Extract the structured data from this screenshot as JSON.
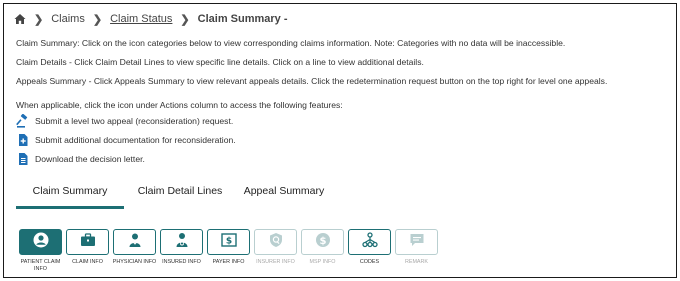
{
  "breadcrumb": {
    "home_icon": "home-icon",
    "items": [
      "Claims",
      "Claim Status",
      "Claim Summary -"
    ]
  },
  "instructions": {
    "summary": "Claim Summary: Click on the icon categories below to view corresponding claims information. Note: Categories with no data will be inaccessible.",
    "details": "Claim Details - Click Claim Detail Lines to view specific line details. Click on a line to view additional details.",
    "appeals": "Appeals Summary - Click Appeals Summary to view relevant appeals details. Click the redetermination request button on the top right for level one appeals.",
    "actions_intro": "When applicable, click the icon under Actions column to access the following features:"
  },
  "actions": [
    {
      "icon": "gavel-icon",
      "label": "Submit a level two appeal (reconsideration) request."
    },
    {
      "icon": "document-add-icon",
      "label": "Submit additional documentation for reconsideration."
    },
    {
      "icon": "document-download-icon",
      "label": "Download the decision letter."
    }
  ],
  "tabs": [
    {
      "label": "Claim Summary",
      "active": true
    },
    {
      "label": "Claim Detail Lines",
      "active": false
    },
    {
      "label": "Appeal Summary",
      "active": false
    }
  ],
  "categories": [
    {
      "label": "PATIENT CLAIM INFO",
      "icon": "user-circle-icon",
      "state": "active"
    },
    {
      "label": "CLAIM INFO",
      "icon": "briefcase-icon",
      "state": "enabled"
    },
    {
      "label": "PHYSICIAN INFO",
      "icon": "physician-icon",
      "state": "enabled"
    },
    {
      "label": "INSURED INFO",
      "icon": "insured-person-icon",
      "state": "enabled"
    },
    {
      "label": "PAYER INFO",
      "icon": "dollar-bill-icon",
      "state": "enabled"
    },
    {
      "label": "INSURER INFO",
      "icon": "shield-icon",
      "state": "disabled"
    },
    {
      "label": "MSP INFO",
      "icon": "dollar-circle-icon",
      "state": "disabled"
    },
    {
      "label": "CODES",
      "icon": "hierarchy-icon",
      "state": "enabled"
    },
    {
      "label": "REMARK",
      "icon": "comment-icon",
      "state": "disabled"
    }
  ],
  "colors": {
    "accent": "#1d6f74",
    "disabled": "#b9cfd0",
    "action_icon": "#1f6fb5"
  }
}
